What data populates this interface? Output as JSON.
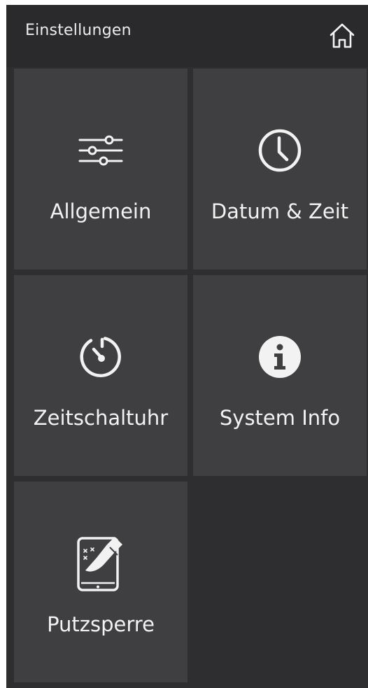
{
  "header": {
    "title": "Einstellungen",
    "home_icon": "home-icon"
  },
  "tiles": [
    {
      "label": "Allgemein",
      "icon": "sliders-icon"
    },
    {
      "label": "Datum & Zeit",
      "icon": "clock-icon"
    },
    {
      "label": "Zeitschaltuhr",
      "icon": "timer-icon"
    },
    {
      "label": "System Info",
      "icon": "info-icon"
    },
    {
      "label": "Putzsperre",
      "icon": "tablet-cleaning-icon"
    }
  ],
  "colors": {
    "background": "#2e2e30",
    "header": "#2a2a2c",
    "tile": "#3f3f41",
    "text": "#f2f2f2"
  }
}
